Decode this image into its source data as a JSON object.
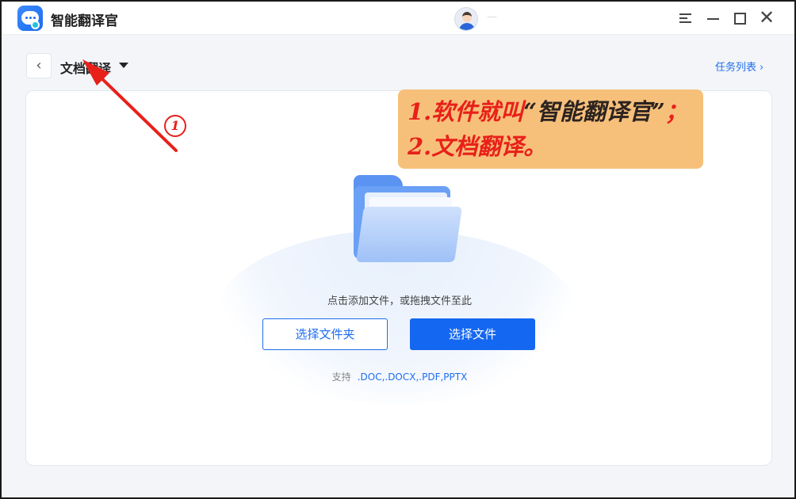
{
  "app": {
    "title": "智能翻译官",
    "user_name": "—",
    "window_controls": [
      "menu-icon",
      "minimize-icon",
      "maximize-icon",
      "close-icon"
    ],
    "close_glyph": "✕"
  },
  "toolbar": {
    "back_glyph": "‹",
    "mode_label": "文档翻译",
    "task_list_label": "任务列表",
    "task_list_chevron": "›"
  },
  "upload": {
    "hint": "点击添加文件，或拖拽文件至此",
    "choose_folder_label": "选择文件夹",
    "choose_file_label": "选择文件",
    "formats_label": "支持",
    "formats_value": ".DOC,.DOCX,.PDF,PPTX"
  },
  "annotation": {
    "line1_prefix": "1.软件就叫",
    "line1_name": "“智能翻译官”",
    "line1_suffix": "；",
    "line2": "2.文档翻译。",
    "marker": "1"
  },
  "colors": {
    "accent": "#1467f0",
    "annotation_red": "#e8201a",
    "callout_bg": "#f7c07a"
  }
}
